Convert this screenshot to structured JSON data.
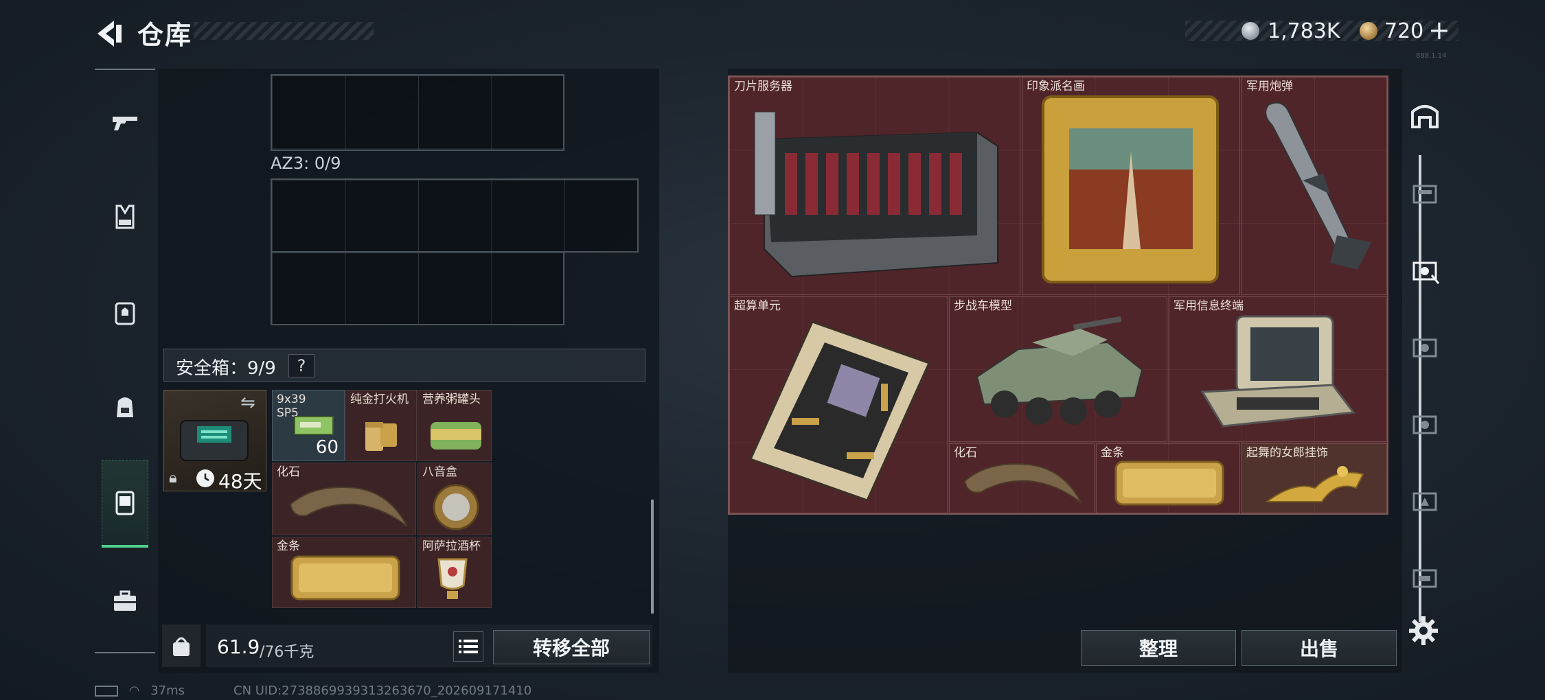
{
  "header": {
    "title": "仓库",
    "currency_silver": "1,783K",
    "currency_gold": "720",
    "plus_label": "+",
    "tiny_text": "888.1.14"
  },
  "left_nav": {
    "items": [
      "gun-icon",
      "vest-icon",
      "backpack-icon",
      "chest-rig-icon",
      "safebox-icon",
      "briefcase-icon"
    ],
    "active": "safebox-icon"
  },
  "containers": {
    "az3_label": "AZ3: 0/9"
  },
  "safe": {
    "label": "安全箱：9/9",
    "help": "?",
    "timer": "48天",
    "items": [
      {
        "label": "9x39\nSP5",
        "count": "60"
      },
      {
        "label": "纯金打火机"
      },
      {
        "label": "营养粥罐头"
      },
      {
        "label": "化石"
      },
      {
        "label": "八音盒"
      },
      {
        "label": "金条"
      },
      {
        "label": "阿萨拉酒杯"
      }
    ]
  },
  "weight": {
    "value": "61.9",
    "max": "/76千克"
  },
  "buttons": {
    "transfer_all": "转移全部",
    "sort": "整理",
    "sell": "出售"
  },
  "stash_items": [
    {
      "label": "刀片服务器"
    },
    {
      "label": "印象派名画"
    },
    {
      "label": "军用炮弹"
    },
    {
      "label": "超算单元"
    },
    {
      "label": "步战车模型"
    },
    {
      "label": "军用信息终端"
    },
    {
      "label": "化石"
    },
    {
      "label": "金条"
    },
    {
      "label": "起舞的女郎挂饰"
    }
  ],
  "status_bar": {
    "ping": "37ms",
    "uid": "CN UID:2738869939313263670_202609171410"
  },
  "colors": {
    "accent_green": "#4fd08b",
    "stash_bg": "#4a2429",
    "gold": "#c9a24a"
  }
}
